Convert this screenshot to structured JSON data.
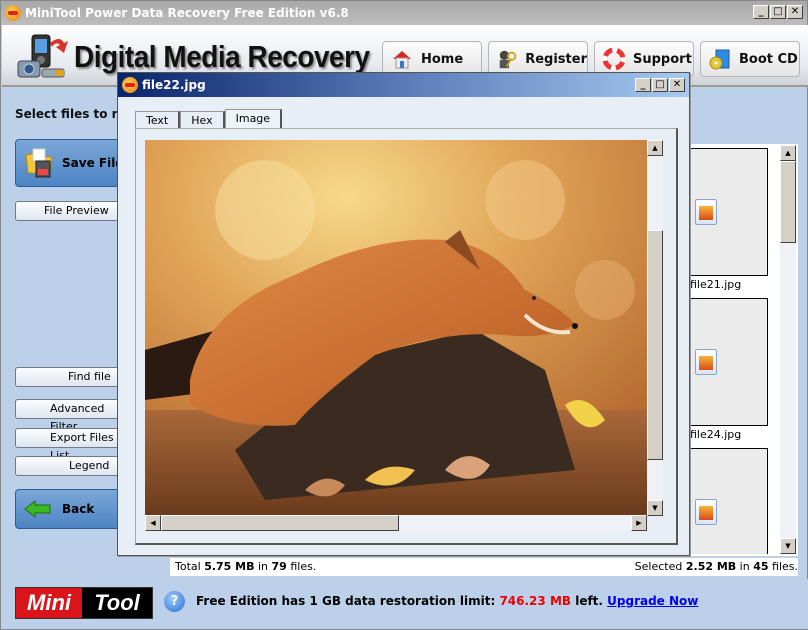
{
  "window": {
    "title": "MiniTool Power Data Recovery Free Edition v6.8",
    "controls": {
      "minimize": "_",
      "maximize": "□",
      "close": "✕"
    }
  },
  "header": {
    "brand": "Digital Media Recovery",
    "nav": [
      {
        "label": "Home",
        "icon": "home-icon"
      },
      {
        "label": "Register",
        "icon": "key-icon"
      },
      {
        "label": "Support",
        "icon": "lifebuoy-icon"
      },
      {
        "label": "Boot CD",
        "icon": "boot-cd-icon"
      }
    ]
  },
  "sidebar": {
    "title": "Select files to recover",
    "save_files": "Save Files",
    "file_preview": "File Preview",
    "find_file": "Find file",
    "advanced_filter": "Advanced Filter",
    "export_files_list": "Export Files List",
    "legend": "Legend",
    "back": "Back"
  },
  "files": [
    {
      "name": "file21.jpg"
    },
    {
      "name": "file24.jpg"
    },
    {
      "name": ""
    }
  ],
  "status": {
    "total_prefix": "Total ",
    "total_size": "5.75 MB",
    "total_mid": " in ",
    "total_count": "79",
    "total_suffix": " files.",
    "selected_prefix": "Selected ",
    "selected_size": "2.52 MB",
    "selected_mid": " in ",
    "selected_count": "45",
    "selected_suffix": " files."
  },
  "footer": {
    "logo_a": "Mini",
    "logo_b": "Tool",
    "help": "?",
    "limit_text": "Free Edition has 1 GB data restoration limit: ",
    "remaining": "746.23 MB",
    "left_text": " left. ",
    "upgrade": "Upgrade Now",
    "remaining_color": "#ee0000"
  },
  "preview_dialog": {
    "title": "file22.jpg",
    "tabs": [
      {
        "label": "Text",
        "active": false
      },
      {
        "label": "Hex",
        "active": false
      },
      {
        "label": "Image",
        "active": true
      }
    ],
    "image_description": "Red fox resting on a tree stump among autumn leaves"
  }
}
